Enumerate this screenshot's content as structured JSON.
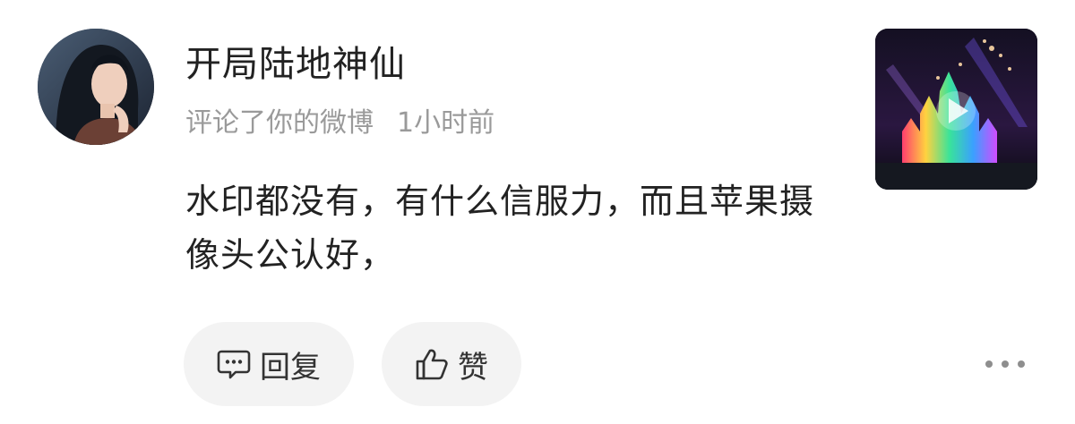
{
  "comment": {
    "username": "开局陆地神仙",
    "action_text": "评论了你的微博",
    "time": "1小时前",
    "text": "水印都没有，有什么信服力，而且苹果摄像头公认好，"
  },
  "actions": {
    "reply_label": "回复",
    "like_label": "赞"
  },
  "icons": {
    "avatar": "user-avatar",
    "thumbnail": "video-thumbnail",
    "play": "play-icon",
    "reply": "comment-icon",
    "like": "thumbs-up-icon",
    "more": "more-icon"
  },
  "colors": {
    "username": "#222222",
    "meta": "#9a9a9a",
    "pill_background": "#f3f3f3"
  }
}
